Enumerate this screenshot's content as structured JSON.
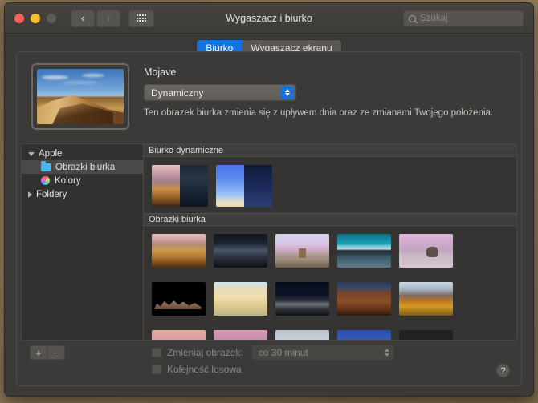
{
  "window": {
    "title": "Wygaszacz i biurko",
    "traffic_lights": [
      "close",
      "minimize",
      "zoom"
    ]
  },
  "toolbar": {
    "back_glyph": "‹",
    "forward_glyph": "›",
    "show_all_name": "show-all-grid",
    "search_placeholder": "Szukaj"
  },
  "tabs": [
    {
      "label": "Biurko",
      "active": true
    },
    {
      "label": "Wygaszacz ekranu",
      "active": false
    }
  ],
  "preview": {
    "wallpaper_name": "Mojave",
    "style_value": "Dynamiczny",
    "description": "Ten obrazek biurka zmienia się z upływem dnia oraz ze zmianami Twojego położenia."
  },
  "sidebar": {
    "items": [
      {
        "label": "Apple",
        "level": 0,
        "disclosure": "open",
        "icon": "none",
        "selected": false
      },
      {
        "label": "Obrazki biurka",
        "level": 1,
        "disclosure": "none",
        "icon": "folder-icon",
        "selected": true
      },
      {
        "label": "Kolory",
        "level": 1,
        "disclosure": "none",
        "icon": "color-wheel-icon",
        "selected": false
      },
      {
        "label": "Foldery",
        "level": 0,
        "disclosure": "closed",
        "icon": "none",
        "selected": false
      }
    ]
  },
  "gallery": {
    "groups": [
      {
        "title": "Biurko dynamiczne",
        "kind": "dynamic",
        "thumbs": [
          {
            "name": "mojave-dynamic",
            "selected": false,
            "day": "mojave-day",
            "night": "mojave-night"
          },
          {
            "name": "solar-gradients-dynamic",
            "selected": false,
            "day": "gradient-day",
            "night": "gradient-night"
          }
        ]
      },
      {
        "title": "Obrazki biurka",
        "kind": "still",
        "rows": [
          [
            {
              "name": "mojave-day"
            },
            {
              "name": "mojave-night"
            },
            {
              "name": "desert-butte-dusk"
            },
            {
              "name": "dark-lake-teal-sky"
            },
            {
              "name": "pink-salt-flat-rock"
            }
          ],
          [
            {
              "name": "black-rock-formation"
            },
            {
              "name": "pale-sand-dunes"
            },
            {
              "name": "dark-dune-night"
            },
            {
              "name": "red-rock-cliffs"
            },
            {
              "name": "autumn-mountain-lake"
            }
          ],
          [
            {
              "name": "pink-sunset-clouds"
            },
            {
              "name": "violet-sunset-sky"
            },
            {
              "name": "grey-cloud-mesa"
            },
            {
              "name": "blue-gradient-sky"
            },
            {
              "name": "golden-sunrise-ridge"
            }
          ]
        ]
      }
    ]
  },
  "bottom": {
    "add_label": "+",
    "remove_label": "−",
    "change_picture_label": "Zmieniaj obrazek:",
    "change_picture_checked": false,
    "interval_value": "co 30 minut",
    "random_order_label": "Kolejność losowa",
    "random_order_checked": false,
    "help_label": "?"
  },
  "colors": {
    "accent_blue": "#1273e0",
    "window_bg": "#3b3a38",
    "sidebar_bg": "#323130",
    "gallery_bg": "#353433"
  }
}
